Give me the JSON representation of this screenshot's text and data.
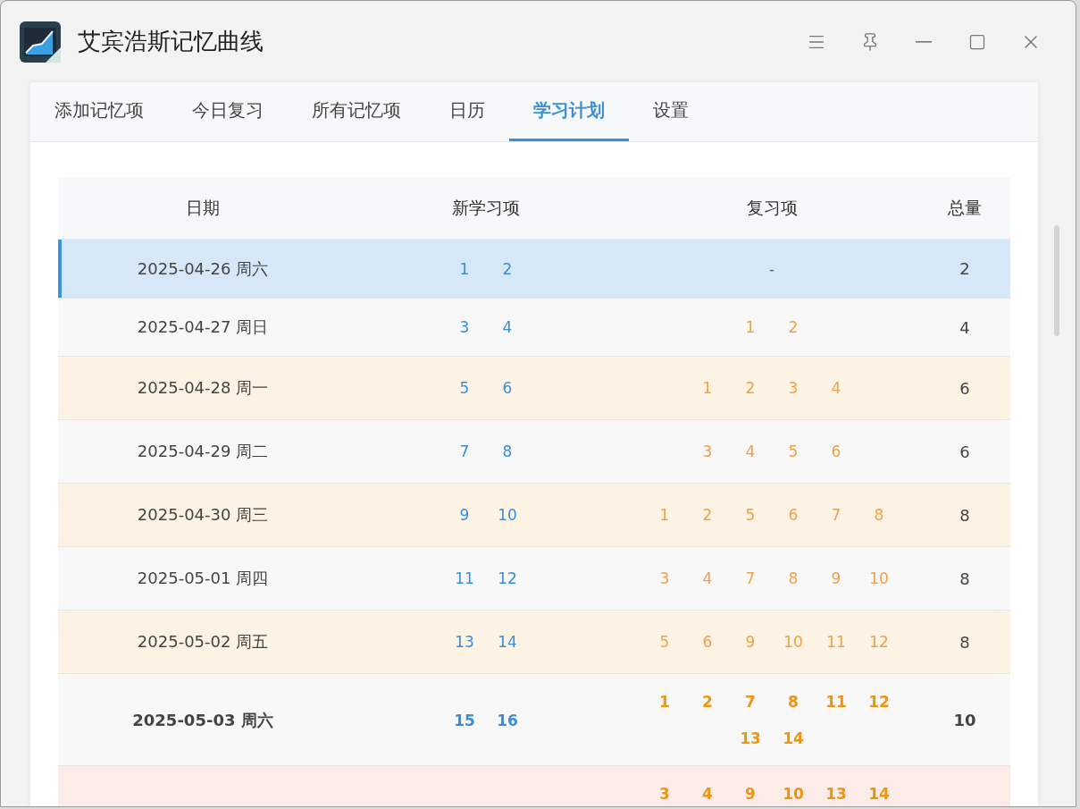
{
  "window": {
    "title": "艾宾浩斯记忆曲线"
  },
  "tabs": [
    {
      "label": "添加记忆项",
      "selected": false
    },
    {
      "label": "今日复习",
      "selected": false
    },
    {
      "label": "所有记忆项",
      "selected": false
    },
    {
      "label": "日历",
      "selected": false
    },
    {
      "label": "学习计划",
      "selected": true
    },
    {
      "label": "设置",
      "selected": false
    }
  ],
  "table": {
    "columns": [
      "日期",
      "新学习项",
      "复习项",
      "总量"
    ],
    "rows": [
      {
        "date": "2025-04-26 周六",
        "new_items": [
          "1",
          "2"
        ],
        "review_empty": "-",
        "total": "2",
        "selected": true,
        "bold": false,
        "color": "#d6e8f7"
      },
      {
        "date": "2025-04-27 周日",
        "new_items": [
          "3",
          "4"
        ],
        "review_items": [
          "1",
          "2"
        ],
        "total": "4",
        "selected": false,
        "bold": false,
        "color": "#f8f8f8"
      },
      {
        "date": "2025-04-28 周一",
        "new_items": [
          "5",
          "6"
        ],
        "review_items": [
          "1",
          "2",
          "3",
          "4"
        ],
        "total": "6",
        "selected": false,
        "bold": false,
        "color": "#fdf3e4"
      },
      {
        "date": "2025-04-29 周二",
        "new_items": [
          "7",
          "8"
        ],
        "review_items": [
          "3",
          "4",
          "5",
          "6"
        ],
        "total": "6",
        "selected": false,
        "bold": false,
        "color": "#f8f8f8"
      },
      {
        "date": "2025-04-30 周三",
        "new_items": [
          "9",
          "10"
        ],
        "review_items": [
          "1",
          "2",
          "5",
          "6",
          "7",
          "8"
        ],
        "total": "8",
        "selected": false,
        "bold": false,
        "color": "#fdf3e4"
      },
      {
        "date": "2025-05-01 周四",
        "new_items": [
          "11",
          "12"
        ],
        "review_items": [
          "3",
          "4",
          "7",
          "8",
          "9",
          "10"
        ],
        "total": "8",
        "selected": false,
        "bold": false,
        "color": "#f8f8f8"
      },
      {
        "date": "2025-05-02 周五",
        "new_items": [
          "13",
          "14"
        ],
        "review_items": [
          "5",
          "6",
          "9",
          "10",
          "11",
          "12"
        ],
        "total": "8",
        "selected": false,
        "bold": false,
        "color": "#fdf3e4"
      },
      {
        "date": "2025-05-03 周六",
        "new_items": [
          "15",
          "16"
        ],
        "review_items": [
          "1",
          "2",
          "7",
          "8",
          "11",
          "12",
          "13",
          "14"
        ],
        "total": "10",
        "selected": false,
        "bold": true,
        "color": "#f8f8f8"
      },
      {
        "review_items": [
          "3",
          "4",
          "9",
          "10",
          "13",
          "14"
        ],
        "selected": false,
        "bold": true,
        "color": "#fcece8"
      }
    ]
  }
}
